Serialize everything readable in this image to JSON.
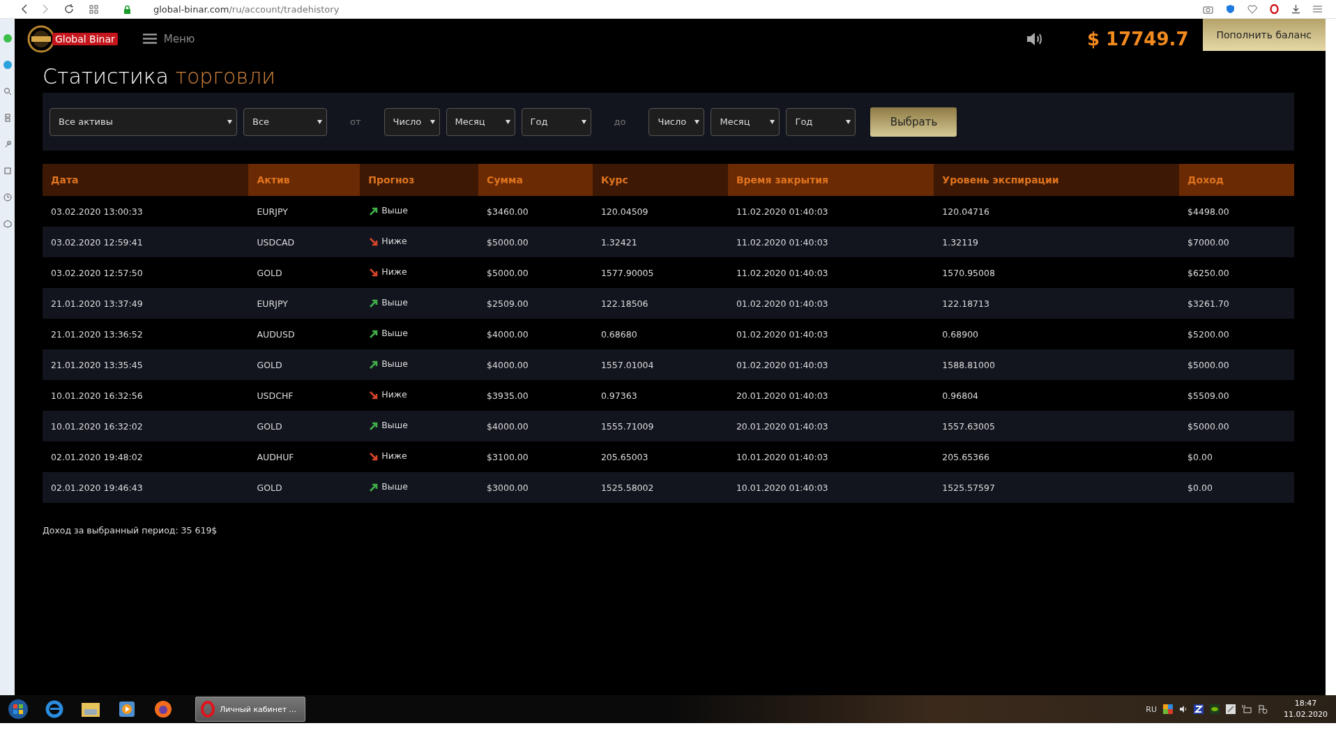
{
  "browser": {
    "url_host": "global-binar.com",
    "url_path": "/ru/account/tradehistory"
  },
  "header": {
    "logo_text": "Global Binar",
    "menu_label": "Меню",
    "balance": "$ 17749.7",
    "deposit_button": "Пополнить баланс"
  },
  "title": {
    "main": "Статистика",
    "accent": "торговли"
  },
  "filters": {
    "asset": "Все активы",
    "type": "Все",
    "from_label": "от",
    "from": [
      "Число",
      "Месяц",
      "Год"
    ],
    "to_label": "до",
    "to": [
      "Число",
      "Месяц",
      "Год"
    ],
    "submit": "Выбрать"
  },
  "table": {
    "columns": [
      "Дата",
      "Актив",
      "Прогноз",
      "Сумма",
      "Курс",
      "Время закрытия",
      "Уровень экспирации",
      "Доход"
    ],
    "rows": [
      {
        "date": "03.02.2020 13:00:33",
        "asset": "EURJPY",
        "kind": "up",
        "forecast": "Выше",
        "amount": "$3460.00",
        "rate": "120.04509",
        "close_time": "11.02.2020 01:40:03",
        "expiry_level": "120.04716",
        "income": "$4498.00"
      },
      {
        "date": "03.02.2020 12:59:41",
        "asset": "USDCAD",
        "kind": "down",
        "forecast": "Ниже",
        "amount": "$5000.00",
        "rate": "1.32421",
        "close_time": "11.02.2020 01:40:03",
        "expiry_level": "1.32119",
        "income": "$7000.00"
      },
      {
        "date": "03.02.2020 12:57:50",
        "asset": "GOLD",
        "kind": "down",
        "forecast": "Ниже",
        "amount": "$5000.00",
        "rate": "1577.90005",
        "close_time": "11.02.2020 01:40:03",
        "expiry_level": "1570.95008",
        "income": "$6250.00"
      },
      {
        "date": "21.01.2020 13:37:49",
        "asset": "EURJPY",
        "kind": "up",
        "forecast": "Выше",
        "amount": "$2509.00",
        "rate": "122.18506",
        "close_time": "01.02.2020 01:40:03",
        "expiry_level": "122.18713",
        "income": "$3261.70"
      },
      {
        "date": "21.01.2020 13:36:52",
        "asset": "AUDUSD",
        "kind": "up",
        "forecast": "Выше",
        "amount": "$4000.00",
        "rate": "0.68680",
        "close_time": "01.02.2020 01:40:03",
        "expiry_level": "0.68900",
        "income": "$5200.00"
      },
      {
        "date": "21.01.2020 13:35:45",
        "asset": "GOLD",
        "kind": "up",
        "forecast": "Выше",
        "amount": "$4000.00",
        "rate": "1557.01004",
        "close_time": "01.02.2020 01:40:03",
        "expiry_level": "1588.81000",
        "income": "$5000.00"
      },
      {
        "date": "10.01.2020 16:32:56",
        "asset": "USDCHF",
        "kind": "down",
        "forecast": "Ниже",
        "amount": "$3935.00",
        "rate": "0.97363",
        "close_time": "20.01.2020 01:40:03",
        "expiry_level": "0.96804",
        "income": "$5509.00"
      },
      {
        "date": "10.01.2020 16:32:02",
        "asset": "GOLD",
        "kind": "up",
        "forecast": "Выше",
        "amount": "$4000.00",
        "rate": "1555.71009",
        "close_time": "20.01.2020 01:40:03",
        "expiry_level": "1557.63005",
        "income": "$5000.00"
      },
      {
        "date": "02.01.2020 19:48:02",
        "asset": "AUDHUF",
        "kind": "down",
        "forecast": "Ниже",
        "amount": "$3100.00",
        "rate": "205.65003",
        "close_time": "10.01.2020 01:40:03",
        "expiry_level": "205.65366",
        "income": "$0.00"
      },
      {
        "date": "02.01.2020 19:46:43",
        "asset": "GOLD",
        "kind": "up",
        "forecast": "Выше",
        "amount": "$3000.00",
        "rate": "1525.58002",
        "close_time": "10.01.2020 01:40:03",
        "expiry_level": "1525.57597",
        "income": "$0.00"
      }
    ]
  },
  "summary": "Доход за выбранный период: 35 619$",
  "taskbar": {
    "active_window": "Личный кабинет ...",
    "language": "RU",
    "time": "18:47",
    "date": "11.02.2020"
  }
}
